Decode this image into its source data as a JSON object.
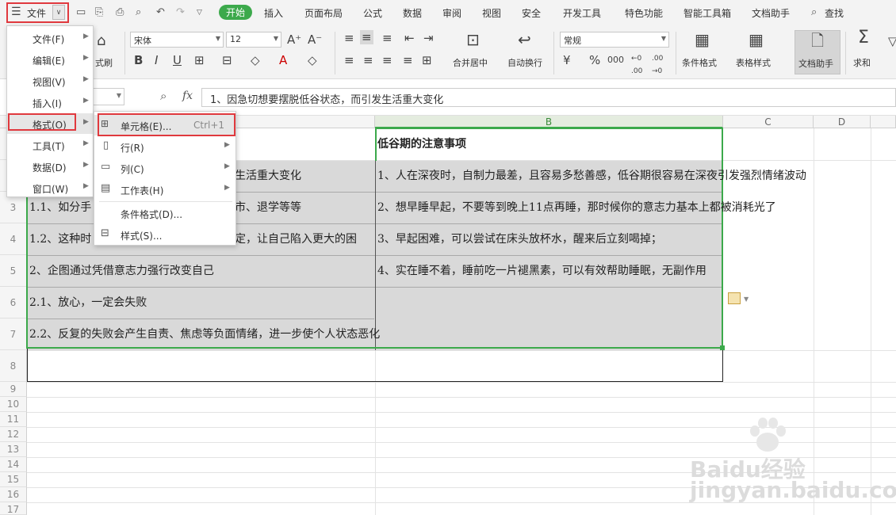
{
  "menubar": {
    "file_label": "文件",
    "tabs": [
      "开始",
      "插入",
      "页面布局",
      "公式",
      "数据",
      "审阅",
      "视图",
      "安全",
      "开发工具",
      "特色功能",
      "智能工具箱",
      "文档助手"
    ],
    "search_label": "查找",
    "accent": "#3ca94b"
  },
  "ribbon": {
    "brush_label": "式刷",
    "font_name": "宋体",
    "font_size": "12",
    "merge_label": "合并居中",
    "wrap_label": "自动换行",
    "number_format": "常规",
    "cond_format_label": "条件格式",
    "table_style_label": "表格样式",
    "doc_helper_label": "文档助手",
    "sum_label": "求和"
  },
  "formula_bar": {
    "fx": "fx",
    "content": "1、因急切想要摆脱低谷状态，而引发生活重大变化"
  },
  "columns": [
    "B",
    "C",
    "D"
  ],
  "rows": [
    "3",
    "4",
    "5",
    "6",
    "7",
    "8",
    "9",
    "10",
    "11",
    "12",
    "13",
    "14",
    "15",
    "16",
    "17"
  ],
  "cells": {
    "b1": "低谷期的注意事项",
    "a2": "生活重大变化",
    "b2": "1、人在深夜时，自制力最差，且容易多愁善感，低谷期很容易在深夜引发强烈情绪波动",
    "a3": "1.1、如分手",
    "a3b": "市、退学等等",
    "b3": "2、想早睡早起，不要等到晚上11点再睡，那时候你的意志力基本上都被消耗光了",
    "a4": "1.2、这种时",
    "a4b": "定，让自己陷入更大的困",
    "b4": "3、早起困难，可以尝试在床头放杯水，醒来后立刻喝掉；",
    "a5": "2、企图通过凭借意志力强行改变自己",
    "b5": "4、实在睡不着，睡前吃一片褪黑素，可以有效帮助睡眠，无副作用",
    "a6": "2.1、放心，一定会失败",
    "a7": "2.2、反复的失败会产生自责、焦虑等负面情绪，进一步使个人状态恶化"
  },
  "file_menu": {
    "items": [
      {
        "label": "文件(F)"
      },
      {
        "label": "编辑(E)"
      },
      {
        "label": "视图(V)"
      },
      {
        "label": "插入(I)"
      },
      {
        "label": "格式(O)"
      },
      {
        "label": "工具(T)"
      },
      {
        "label": "数据(D)"
      },
      {
        "label": "窗口(W)"
      }
    ]
  },
  "format_submenu": {
    "items": [
      {
        "label": "单元格(E)...",
        "shortcut": "Ctrl+1"
      },
      {
        "label": "行(R)"
      },
      {
        "label": "列(C)"
      },
      {
        "label": "工作表(H)"
      },
      {
        "label": "条件格式(D)..."
      },
      {
        "label": "样式(S)..."
      }
    ]
  },
  "watermark": "Baidu经验 jingyan.baidu.com",
  "colors": {
    "highlight": "#e0393e",
    "selection_border": "#3ca94b",
    "cell_fill": "#d9d9d9"
  }
}
